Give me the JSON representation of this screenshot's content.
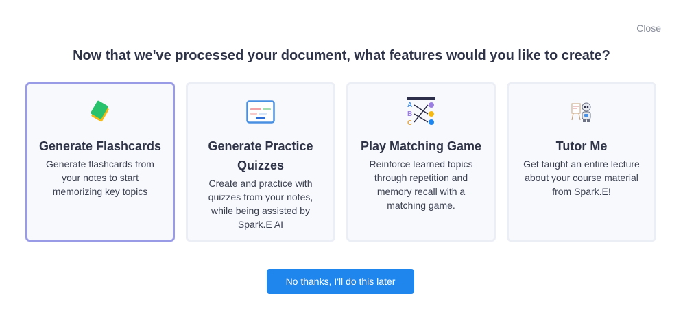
{
  "dialog": {
    "close_label": "Close",
    "heading": "Now that we've processed your document, what features would you like to create?"
  },
  "features": [
    {
      "title": "Generate Flashcards",
      "description": "Generate flashcards from your notes to start memorizing key topics",
      "icon": "flashcards-icon",
      "selected": true
    },
    {
      "title": "Generate Practice Quizzes",
      "description": "Create and practice with quizzes from your notes, while being assisted by Spark.E AI",
      "icon": "quiz-icon",
      "selected": false
    },
    {
      "title": "Play Matching Game",
      "description": "Reinforce learned topics through repetition and memory recall with a matching game.",
      "icon": "matching-game-icon",
      "selected": false
    },
    {
      "title": "Tutor Me",
      "description": "Get taught an entire lecture about your course material from Spark.E!",
      "icon": "tutor-robot-icon",
      "selected": false
    }
  ],
  "matching_icon_letters": [
    "A",
    "B",
    "C"
  ],
  "actions": {
    "decline_label": "No thanks, I'll do this later"
  },
  "colors": {
    "accent": "#1f86ee",
    "selected_border": "#9a9be6",
    "card_bg": "#f8f9fc"
  }
}
